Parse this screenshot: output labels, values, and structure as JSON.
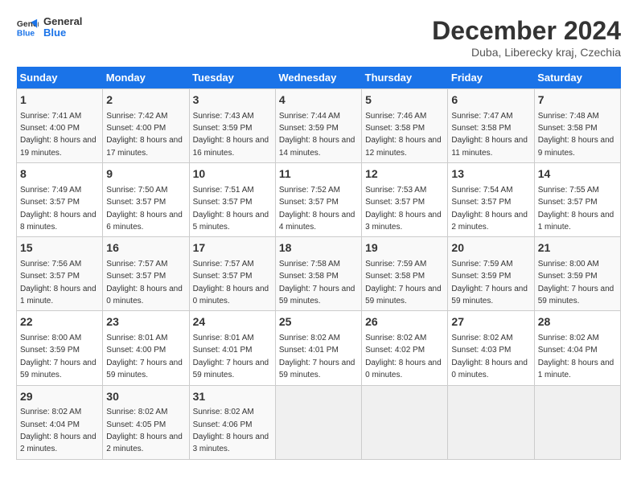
{
  "logo": {
    "line1": "General",
    "line2": "Blue"
  },
  "title": "December 2024",
  "subtitle": "Duba, Liberecky kraj, Czechia",
  "days_of_week": [
    "Sunday",
    "Monday",
    "Tuesday",
    "Wednesday",
    "Thursday",
    "Friday",
    "Saturday"
  ],
  "weeks": [
    [
      {
        "day": "1",
        "info": "Sunrise: 7:41 AM\nSunset: 4:00 PM\nDaylight: 8 hours and 19 minutes."
      },
      {
        "day": "2",
        "info": "Sunrise: 7:42 AM\nSunset: 4:00 PM\nDaylight: 8 hours and 17 minutes."
      },
      {
        "day": "3",
        "info": "Sunrise: 7:43 AM\nSunset: 3:59 PM\nDaylight: 8 hours and 16 minutes."
      },
      {
        "day": "4",
        "info": "Sunrise: 7:44 AM\nSunset: 3:59 PM\nDaylight: 8 hours and 14 minutes."
      },
      {
        "day": "5",
        "info": "Sunrise: 7:46 AM\nSunset: 3:58 PM\nDaylight: 8 hours and 12 minutes."
      },
      {
        "day": "6",
        "info": "Sunrise: 7:47 AM\nSunset: 3:58 PM\nDaylight: 8 hours and 11 minutes."
      },
      {
        "day": "7",
        "info": "Sunrise: 7:48 AM\nSunset: 3:58 PM\nDaylight: 8 hours and 9 minutes."
      }
    ],
    [
      {
        "day": "8",
        "info": "Sunrise: 7:49 AM\nSunset: 3:57 PM\nDaylight: 8 hours and 8 minutes."
      },
      {
        "day": "9",
        "info": "Sunrise: 7:50 AM\nSunset: 3:57 PM\nDaylight: 8 hours and 6 minutes."
      },
      {
        "day": "10",
        "info": "Sunrise: 7:51 AM\nSunset: 3:57 PM\nDaylight: 8 hours and 5 minutes."
      },
      {
        "day": "11",
        "info": "Sunrise: 7:52 AM\nSunset: 3:57 PM\nDaylight: 8 hours and 4 minutes."
      },
      {
        "day": "12",
        "info": "Sunrise: 7:53 AM\nSunset: 3:57 PM\nDaylight: 8 hours and 3 minutes."
      },
      {
        "day": "13",
        "info": "Sunrise: 7:54 AM\nSunset: 3:57 PM\nDaylight: 8 hours and 2 minutes."
      },
      {
        "day": "14",
        "info": "Sunrise: 7:55 AM\nSunset: 3:57 PM\nDaylight: 8 hours and 1 minute."
      }
    ],
    [
      {
        "day": "15",
        "info": "Sunrise: 7:56 AM\nSunset: 3:57 PM\nDaylight: 8 hours and 1 minute."
      },
      {
        "day": "16",
        "info": "Sunrise: 7:57 AM\nSunset: 3:57 PM\nDaylight: 8 hours and 0 minutes."
      },
      {
        "day": "17",
        "info": "Sunrise: 7:57 AM\nSunset: 3:57 PM\nDaylight: 8 hours and 0 minutes."
      },
      {
        "day": "18",
        "info": "Sunrise: 7:58 AM\nSunset: 3:58 PM\nDaylight: 7 hours and 59 minutes."
      },
      {
        "day": "19",
        "info": "Sunrise: 7:59 AM\nSunset: 3:58 PM\nDaylight: 7 hours and 59 minutes."
      },
      {
        "day": "20",
        "info": "Sunrise: 7:59 AM\nSunset: 3:59 PM\nDaylight: 7 hours and 59 minutes."
      },
      {
        "day": "21",
        "info": "Sunrise: 8:00 AM\nSunset: 3:59 PM\nDaylight: 7 hours and 59 minutes."
      }
    ],
    [
      {
        "day": "22",
        "info": "Sunrise: 8:00 AM\nSunset: 3:59 PM\nDaylight: 7 hours and 59 minutes."
      },
      {
        "day": "23",
        "info": "Sunrise: 8:01 AM\nSunset: 4:00 PM\nDaylight: 7 hours and 59 minutes."
      },
      {
        "day": "24",
        "info": "Sunrise: 8:01 AM\nSunset: 4:01 PM\nDaylight: 7 hours and 59 minutes."
      },
      {
        "day": "25",
        "info": "Sunrise: 8:02 AM\nSunset: 4:01 PM\nDaylight: 7 hours and 59 minutes."
      },
      {
        "day": "26",
        "info": "Sunrise: 8:02 AM\nSunset: 4:02 PM\nDaylight: 8 hours and 0 minutes."
      },
      {
        "day": "27",
        "info": "Sunrise: 8:02 AM\nSunset: 4:03 PM\nDaylight: 8 hours and 0 minutes."
      },
      {
        "day": "28",
        "info": "Sunrise: 8:02 AM\nSunset: 4:04 PM\nDaylight: 8 hours and 1 minute."
      }
    ],
    [
      {
        "day": "29",
        "info": "Sunrise: 8:02 AM\nSunset: 4:04 PM\nDaylight: 8 hours and 2 minutes."
      },
      {
        "day": "30",
        "info": "Sunrise: 8:02 AM\nSunset: 4:05 PM\nDaylight: 8 hours and 2 minutes."
      },
      {
        "day": "31",
        "info": "Sunrise: 8:02 AM\nSunset: 4:06 PM\nDaylight: 8 hours and 3 minutes."
      },
      null,
      null,
      null,
      null
    ]
  ]
}
